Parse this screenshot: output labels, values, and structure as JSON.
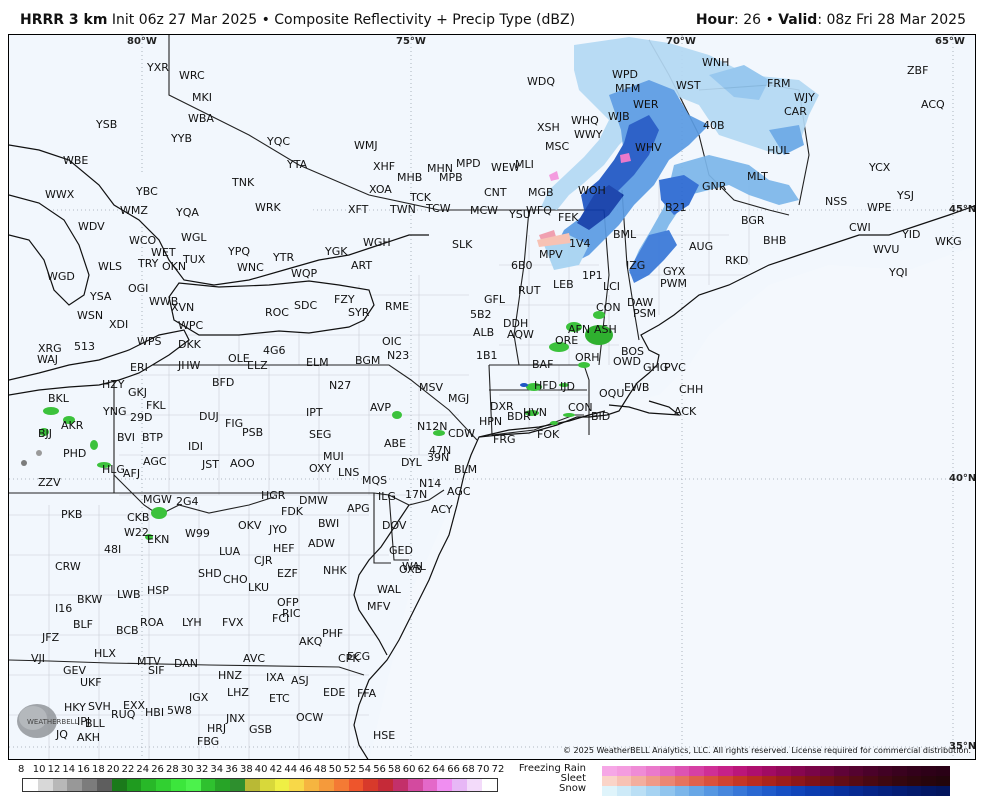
{
  "header": {
    "model": "HRRR 3 km",
    "init": "Init 06z 27 Mar 2025",
    "product": "Composite Reflectivity + Precip Type (dBZ)",
    "hour_label": "Hour",
    "hour_value": ": 26",
    "valid_label": "Valid",
    "valid_value": ": 08z Fri 28 Mar 2025",
    "separator": "•"
  },
  "map": {
    "longitude_labels": [
      "80°W",
      "75°W",
      "70°W",
      "65°W"
    ],
    "latitude_labels": [
      "45°N",
      "40°N",
      "35°N"
    ],
    "stations": [
      [
        "YXR",
        150,
        66
      ],
      [
        "WRC",
        182,
        74
      ],
      [
        "YSB",
        99,
        123
      ],
      [
        "WBA",
        191,
        117
      ],
      [
        "YYB",
        174,
        137
      ],
      [
        "YQC",
        270,
        140
      ],
      [
        "WMJ",
        357,
        144
      ],
      [
        "WDQ",
        530,
        80
      ],
      [
        "WPD",
        615,
        73
      ],
      [
        "MFM",
        618,
        87
      ],
      [
        "WST",
        679,
        84
      ],
      [
        "WNH",
        705,
        61
      ],
      [
        "FRM",
        770,
        82
      ],
      [
        "ZBF",
        910,
        69
      ],
      [
        "ACQ",
        924,
        103
      ],
      [
        "MKI",
        195,
        96
      ],
      [
        "WJY",
        797,
        96
      ],
      [
        "CAR",
        787,
        110
      ],
      [
        "WHQ",
        574,
        119
      ],
      [
        "WJB",
        611,
        115
      ],
      [
        "WER",
        636,
        103
      ],
      [
        "XSH",
        540,
        126
      ],
      [
        "WWY",
        577,
        133
      ],
      [
        "MSC",
        548,
        145
      ],
      [
        "40B",
        706,
        124
      ],
      [
        "WHV",
        638,
        146
      ],
      [
        "HUL",
        770,
        149
      ],
      [
        "MLT",
        750,
        175
      ],
      [
        "YCX",
        872,
        166
      ],
      [
        "GNR",
        705,
        185
      ],
      [
        "YSJ",
        900,
        194
      ],
      [
        "NSS",
        828,
        200
      ],
      [
        "WPE",
        870,
        206
      ],
      [
        "WBE",
        66,
        159
      ],
      [
        "YTA",
        290,
        163
      ],
      [
        "XHF",
        376,
        165
      ],
      [
        "MHB",
        400,
        176
      ],
      [
        "MPB",
        442,
        176
      ],
      [
        "MPD",
        459,
        162
      ],
      [
        "MHN",
        430,
        167
      ],
      [
        "WEW",
        494,
        166
      ],
      [
        "MLI",
        518,
        163
      ],
      [
        "CNT",
        487,
        191
      ],
      [
        "MGB",
        531,
        191
      ],
      [
        "TNK",
        235,
        181
      ],
      [
        "XOA",
        372,
        188
      ],
      [
        "TCK",
        413,
        196
      ],
      [
        "WWX",
        48,
        193
      ],
      [
        "YBC",
        139,
        190
      ],
      [
        "WMZ",
        123,
        209
      ],
      [
        "YQA",
        179,
        211
      ],
      [
        "WRK",
        258,
        206
      ],
      [
        "XFT",
        351,
        208
      ],
      [
        "TWN",
        393,
        208
      ],
      [
        "TCW",
        429,
        207
      ],
      [
        "MCW",
        473,
        209
      ],
      [
        "WFQ",
        529,
        209
      ],
      [
        "WOH",
        581,
        189
      ],
      [
        "B21",
        668,
        206
      ],
      [
        "BGR",
        744,
        219
      ],
      [
        "YSU",
        512,
        213
      ],
      [
        "FEK",
        561,
        216
      ],
      [
        "WDV",
        81,
        225
      ],
      [
        "WCO",
        132,
        239
      ],
      [
        "YPQ",
        231,
        250
      ],
      [
        "WGL",
        184,
        236
      ],
      [
        "WGH",
        366,
        241
      ],
      [
        "SLK",
        455,
        243
      ],
      [
        "1V4",
        572,
        242
      ],
      [
        "BML",
        616,
        233
      ],
      [
        "AUG",
        692,
        245
      ],
      [
        "BHB",
        766,
        239
      ],
      [
        "CWI",
        852,
        226
      ],
      [
        "YID",
        905,
        233
      ],
      [
        "WKG",
        938,
        240
      ],
      [
        "WVU",
        876,
        248
      ],
      [
        "WGD",
        50,
        275
      ],
      [
        "WET",
        154,
        251
      ],
      [
        "TUX",
        186,
        258
      ],
      [
        "TRY",
        141,
        262
      ],
      [
        "OKN",
        165,
        265
      ],
      [
        "WNC",
        240,
        266
      ],
      [
        "YTR",
        276,
        256
      ],
      [
        "YGK",
        328,
        250
      ],
      [
        "ART",
        354,
        264
      ],
      [
        "WQP",
        294,
        272
      ],
      [
        "MPV",
        542,
        253
      ],
      [
        "6B0",
        514,
        264
      ],
      [
        "IZG",
        629,
        264
      ],
      [
        "GYX",
        666,
        270
      ],
      [
        "RKD",
        728,
        259
      ],
      [
        "YQI",
        892,
        271
      ],
      [
        "WLS",
        101,
        265
      ],
      [
        "OGI",
        131,
        287
      ],
      [
        "1P1",
        585,
        274
      ],
      [
        "PWM",
        663,
        282
      ],
      [
        "LEB",
        556,
        283
      ],
      [
        "RUT",
        521,
        289
      ],
      [
        "LCI",
        606,
        285
      ],
      [
        "YSA",
        93,
        295
      ],
      [
        "WWB",
        152,
        300
      ],
      [
        "XVN",
        174,
        306
      ],
      [
        "FZY",
        337,
        298
      ],
      [
        "RME",
        388,
        305
      ],
      [
        "GFL",
        487,
        298
      ],
      [
        "DAW",
        630,
        301
      ],
      [
        "CON",
        599,
        306
      ],
      [
        "SYR",
        351,
        311
      ],
      [
        "ROC",
        268,
        311
      ],
      [
        "SDC",
        297,
        304
      ],
      [
        "WSN",
        80,
        314
      ],
      [
        "5B2",
        473,
        313
      ],
      [
        "PSM",
        636,
        312
      ],
      [
        "DDH",
        506,
        322
      ],
      [
        "WPC",
        181,
        324
      ],
      [
        "XDI",
        112,
        323
      ],
      [
        "AQW",
        510,
        333
      ],
      [
        "ALB",
        476,
        331
      ],
      [
        "AFN",
        571,
        328
      ],
      [
        "ASH",
        597,
        328
      ],
      [
        "WPS",
        140,
        340
      ],
      [
        "DKK",
        181,
        343
      ],
      [
        "4G6",
        266,
        349
      ],
      [
        "OIC",
        385,
        340
      ],
      [
        "XRG",
        41,
        347
      ],
      [
        "513",
        77,
        345
      ],
      [
        "N23",
        390,
        354
      ],
      [
        "1B1",
        479,
        354
      ],
      [
        "ORE",
        558,
        339
      ],
      [
        "ORH",
        578,
        356
      ],
      [
        "BOS",
        624,
        350
      ],
      [
        "WAJ",
        40,
        358
      ],
      [
        "OLE",
        231,
        357
      ],
      [
        "ELZ",
        250,
        364
      ],
      [
        "ELM",
        309,
        361
      ],
      [
        "BGM",
        358,
        359
      ],
      [
        "OWD",
        616,
        360
      ],
      [
        "GHG",
        646,
        366
      ],
      [
        "PVC",
        667,
        366
      ],
      [
        "JHW",
        181,
        364
      ],
      [
        "ERI",
        133,
        366
      ],
      [
        "BAF",
        535,
        363
      ],
      [
        "N27",
        332,
        384
      ],
      [
        "BFD",
        215,
        381
      ],
      [
        "MSV",
        422,
        386
      ],
      [
        "MGJ",
        451,
        397
      ],
      [
        "HFD",
        537,
        384
      ],
      [
        "IJD",
        563,
        385
      ],
      [
        "OQU",
        602,
        392
      ],
      [
        "EWB",
        627,
        386
      ],
      [
        "CHH",
        682,
        388
      ],
      [
        "BKL",
        51,
        397
      ],
      [
        "HZY",
        105,
        383
      ],
      [
        "GKJ",
        131,
        391
      ],
      [
        "FKL",
        149,
        404
      ],
      [
        "AVP",
        373,
        406
      ],
      [
        "CON",
        571,
        406
      ],
      [
        "BID",
        594,
        415
      ],
      [
        "ACK",
        677,
        410
      ],
      [
        "YNG",
        106,
        410
      ],
      [
        "29D",
        133,
        416
      ],
      [
        "DUJ",
        202,
        415
      ],
      [
        "IPT",
        309,
        411
      ],
      [
        "DXR",
        493,
        405
      ],
      [
        "HVN",
        526,
        411
      ],
      [
        "BDR",
        510,
        415
      ],
      [
        "AKR",
        64,
        424
      ],
      [
        "FIG",
        228,
        422
      ],
      [
        "HPN",
        482,
        420
      ],
      [
        "N12N",
        420,
        425
      ],
      [
        "FOK",
        540,
        433
      ],
      [
        "PSB",
        245,
        431
      ],
      [
        "SEG",
        312,
        433
      ],
      [
        "CDW",
        451,
        432
      ],
      [
        "BJJ",
        41,
        432
      ],
      [
        "BVI",
        120,
        436
      ],
      [
        "BTP",
        145,
        436
      ],
      [
        "IDI",
        191,
        445
      ],
      [
        "ABE",
        387,
        442
      ],
      [
        "FRG",
        496,
        438
      ],
      [
        "47N",
        432,
        449
      ],
      [
        "PHD",
        66,
        452
      ],
      [
        "AGC",
        146,
        460
      ],
      [
        "MUI",
        326,
        455
      ],
      [
        "39N",
        430,
        456
      ],
      [
        "DYL",
        404,
        461
      ],
      [
        "HLG",
        105,
        468
      ],
      [
        "AFJ",
        126,
        472
      ],
      [
        "JST",
        205,
        463
      ],
      [
        "AOO",
        233,
        462
      ],
      [
        "OXY",
        312,
        467
      ],
      [
        "LNS",
        341,
        471
      ],
      [
        "BLM",
        457,
        468
      ],
      [
        "ZZV",
        41,
        481
      ],
      [
        "MQS",
        365,
        479
      ],
      [
        "N14",
        422,
        482
      ],
      [
        "HGR",
        264,
        494
      ],
      [
        "17N",
        408,
        493
      ],
      [
        "AGC",
        450,
        490
      ],
      [
        "MGW",
        146,
        498
      ],
      [
        "2G4",
        179,
        500
      ],
      [
        "DMW",
        302,
        499
      ],
      [
        "APG",
        350,
        507
      ],
      [
        "ILG",
        381,
        495
      ],
      [
        "PKB",
        64,
        513
      ],
      [
        "FDK",
        284,
        510
      ],
      [
        "ACY",
        434,
        508
      ],
      [
        "CKB",
        130,
        516
      ],
      [
        "BWI",
        321,
        522
      ],
      [
        "OKV",
        241,
        524
      ],
      [
        "JYO",
        272,
        528
      ],
      [
        "DOV",
        385,
        524
      ],
      [
        "W22",
        127,
        531
      ],
      [
        "EKN",
        150,
        538
      ],
      [
        "W99",
        188,
        532
      ],
      [
        "ADW",
        311,
        542
      ],
      [
        "HEF",
        276,
        547
      ],
      [
        "GED",
        392,
        549
      ],
      [
        "48I",
        107,
        548
      ],
      [
        "LUA",
        222,
        550
      ],
      [
        "CJR",
        257,
        559
      ],
      [
        "WAL",
        405,
        565
      ],
      [
        "CRW",
        58,
        565
      ],
      [
        "SHD",
        201,
        572
      ],
      [
        "CHO",
        226,
        578
      ],
      [
        "EZF",
        280,
        572
      ],
      [
        "NHK",
        326,
        569
      ],
      [
        "OXB",
        402,
        568
      ],
      [
        "LWB",
        120,
        593
      ],
      [
        "HSP",
        150,
        589
      ],
      [
        "LKU",
        251,
        586
      ],
      [
        "BKW",
        80,
        598
      ],
      [
        "OFP",
        280,
        601
      ],
      [
        "RIC",
        285,
        612
      ],
      [
        "WAL",
        380,
        588
      ],
      [
        "I16",
        58,
        607
      ],
      [
        "FVX",
        225,
        621
      ],
      [
        "FCI",
        275,
        617
      ],
      [
        "MFV",
        370,
        605
      ],
      [
        "BLF",
        76,
        623
      ],
      [
        "BCB",
        119,
        629
      ],
      [
        "ROA",
        143,
        621
      ],
      [
        "LYH",
        185,
        621
      ],
      [
        "PHF",
        325,
        632
      ],
      [
        "JFZ",
        45,
        636
      ],
      [
        "AKQ",
        302,
        640
      ],
      [
        "HLX",
        97,
        652
      ],
      [
        "MTV",
        140,
        660
      ],
      [
        "DAN",
        177,
        662
      ],
      [
        "AVC",
        246,
        657
      ],
      [
        "CPK",
        341,
        657
      ],
      [
        "ECG",
        350,
        655
      ],
      [
        "VJI",
        34,
        657
      ],
      [
        "GEV",
        66,
        669
      ],
      [
        "SIF",
        151,
        669
      ],
      [
        "HNZ",
        221,
        674
      ],
      [
        "IXA",
        269,
        676
      ],
      [
        "ASJ",
        294,
        679
      ],
      [
        "FFA",
        360,
        692
      ],
      [
        "UKF",
        83,
        681
      ],
      [
        "IGX",
        192,
        696
      ],
      [
        "LHZ",
        230,
        691
      ],
      [
        "ETC",
        272,
        697
      ],
      [
        "EDE",
        326,
        691
      ],
      [
        "HKY",
        67,
        706
      ],
      [
        "SVH",
        91,
        705
      ],
      [
        "EXX",
        126,
        704
      ],
      [
        "5W8",
        170,
        709
      ],
      [
        "HBI",
        148,
        711
      ],
      [
        "RUQ",
        114,
        713
      ],
      [
        "IPJ",
        80,
        720
      ],
      [
        "HRJ",
        210,
        727
      ],
      [
        "JNX",
        229,
        717
      ],
      [
        "OCW",
        299,
        716
      ],
      [
        "BLL",
        88,
        722
      ],
      [
        "GSB",
        252,
        728
      ],
      [
        "JQ",
        59,
        733
      ],
      [
        "AKH",
        80,
        736
      ],
      [
        "FBG",
        200,
        740
      ],
      [
        "HSE",
        376,
        734
      ]
    ]
  },
  "copyright": "© 2025 WeatherBELL Analytics, LLC. All rights reserved. License required for commercial distribution.",
  "logo_text": "WEATHERBELL",
  "legend": {
    "dbz_ticks": [
      "8",
      "10",
      "12",
      "14",
      "16",
      "18",
      "20",
      "22",
      "24",
      "26",
      "28",
      "30",
      "32",
      "34",
      "36",
      "38",
      "40",
      "42",
      "44",
      "46",
      "48",
      "50",
      "52",
      "54",
      "56",
      "58",
      "60",
      "62",
      "64",
      "66",
      "68",
      "70",
      "72"
    ],
    "ptype_labels": [
      "Freezing Rain",
      "Sleet",
      "Snow"
    ],
    "colors": {
      "dbz": [
        "#ffffff",
        "#d8d8d8",
        "#b8b8b8",
        "#989898",
        "#7c7c7c",
        "#5e5e5e",
        "#1b7a1b",
        "#1f9b1f",
        "#28b828",
        "#31d031",
        "#3ce63c",
        "#4cf24c",
        "#2fc12f",
        "#27a427",
        "#2e8f2e",
        "#b9b935",
        "#d8d83a",
        "#efef44",
        "#f8d848",
        "#f6b540",
        "#f59a3b",
        "#f47a34",
        "#ee552c",
        "#d83a2b",
        "#c52a38",
        "#c3306a",
        "#d34a9f",
        "#e468c9",
        "#f08ef1",
        "#e7b7f6",
        "#f3dbfa",
        "#ffffff"
      ],
      "freezing_rain": [
        "#f6a7e6",
        "#f49cdf",
        "#ef8bd6",
        "#ea79cb",
        "#e466bf",
        "#dd53b2",
        "#d640a4",
        "#cf2f96",
        "#c62188",
        "#bb167a",
        "#ae0f6e",
        "#a10b63",
        "#940859",
        "#870650",
        "#7a0548",
        "#6d0440",
        "#600338",
        "#550330",
        "#4b022a",
        "#420224",
        "#3a021f",
        "#33011b",
        "#2e0118",
        "#2a0116"
      ],
      "sleet": [
        "#fad4c8",
        "#f7c2b4",
        "#f3ae9e",
        "#ef9a88",
        "#eb8673",
        "#e6735e",
        "#e0614c",
        "#d9513d",
        "#d04230",
        "#c53625",
        "#b92c20",
        "#ab241d",
        "#9d1d1b",
        "#8e1719",
        "#7f1218",
        "#711017",
        "#630d16",
        "#560b15",
        "#4a0913",
        "#3f0811",
        "#35070f",
        "#2e060d",
        "#28050c",
        "#23050b"
      ],
      "snow": [
        "#dff4fb",
        "#cdeaf8",
        "#badff5",
        "#a6d3f2",
        "#91c5ee",
        "#7cb6ea",
        "#68a7e6",
        "#5697e2",
        "#4787dd",
        "#3877d8",
        "#2a68d2",
        "#1f5bcb",
        "#164fc3",
        "#1045ba",
        "#0c3db0",
        "#0a36a6",
        "#08309c",
        "#072a92",
        "#062588",
        "#05217e",
        "#041d75",
        "#041a6c",
        "#031764",
        "#03155d"
      ]
    }
  }
}
